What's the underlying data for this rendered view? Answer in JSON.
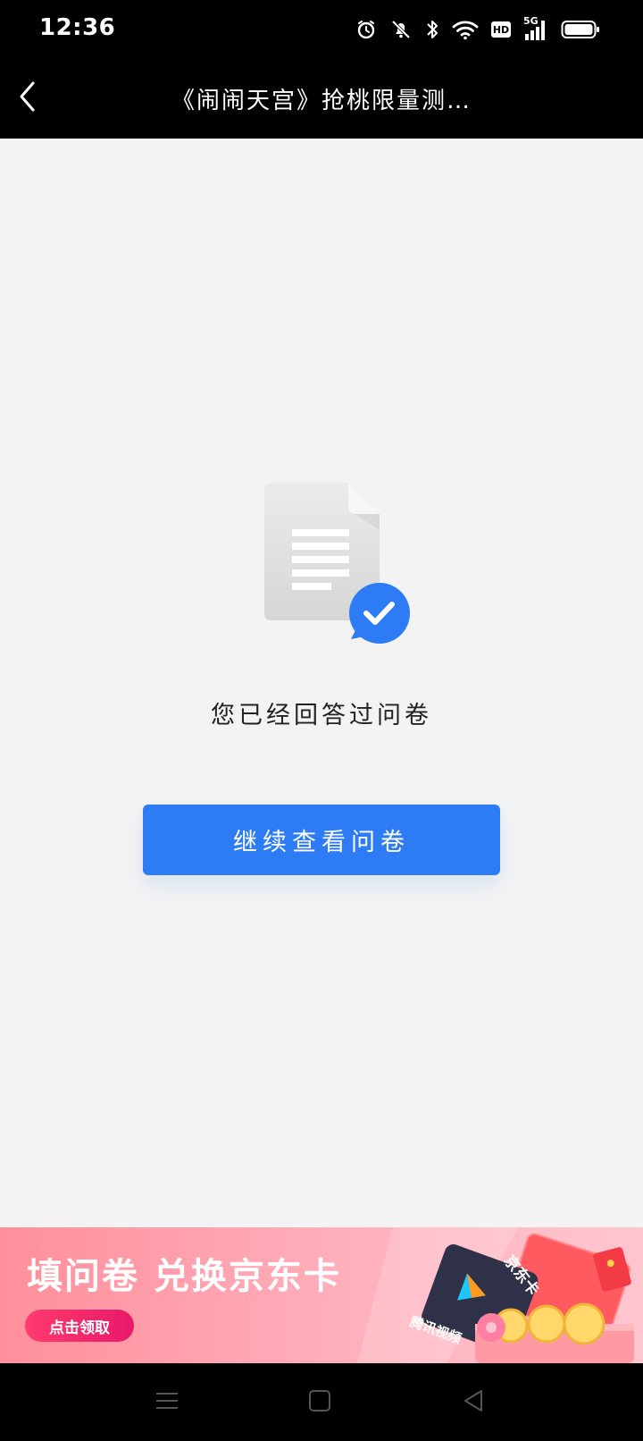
{
  "status_bar": {
    "time": "12:36",
    "icons": [
      "alarm-icon",
      "mute-icon",
      "bluetooth-icon",
      "wifi-icon",
      "hd-icon",
      "5g-signal-icon",
      "battery-icon"
    ],
    "hd_label": "HD",
    "network_label": "5G"
  },
  "header": {
    "title": "《闹闹天宫》抢桃限量测…",
    "back_icon": "chevron-left-icon"
  },
  "main": {
    "illustration_icon": "document-check-icon",
    "message": "您已经回答过问卷",
    "primary_button": "继续查看问卷",
    "accent_color": "#2d7cf5"
  },
  "banner": {
    "title": "填问卷 兑换京东卡",
    "cta": "点击领取",
    "card_tencent_label": "腾讯视频",
    "card_jd_label": "京东卡"
  },
  "nav_bar": {
    "icons": [
      "menu-icon",
      "home-square-icon",
      "back-triangle-icon"
    ]
  }
}
